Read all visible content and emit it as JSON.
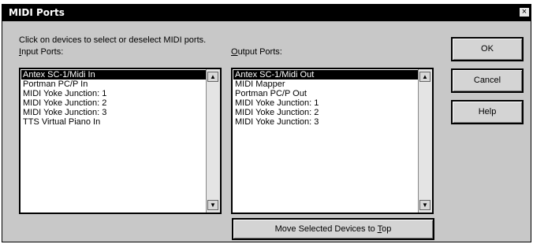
{
  "window": {
    "title": "MIDI Ports",
    "close_glyph": "×"
  },
  "instructions": "Click on devices to select or deselect MIDI ports.",
  "input": {
    "label_prefix": "I",
    "label_rest": "nput Ports:",
    "items": [
      {
        "label": "Antex SC-1/Midi In",
        "selected": true
      },
      {
        "label": "Portman PC/P In",
        "selected": false
      },
      {
        "label": "MIDI Yoke Junction:  1",
        "selected": false
      },
      {
        "label": "MIDI Yoke Junction:  2",
        "selected": false
      },
      {
        "label": "MIDI Yoke Junction:  3",
        "selected": false
      },
      {
        "label": "TTS Virtual Piano In",
        "selected": false
      }
    ]
  },
  "output": {
    "label_prefix": "O",
    "label_rest": "utput Ports:",
    "items": [
      {
        "label": "Antex SC-1/Midi Out",
        "selected": true
      },
      {
        "label": "MIDI Mapper",
        "selected": false
      },
      {
        "label": "Portman PC/P Out",
        "selected": false
      },
      {
        "label": "MIDI Yoke Junction:  1",
        "selected": false
      },
      {
        "label": "MIDI Yoke Junction:  2",
        "selected": false
      },
      {
        "label": "MIDI Yoke Junction:  3",
        "selected": false
      }
    ]
  },
  "buttons": {
    "ok": "OK",
    "cancel": "Cancel",
    "help": "Help",
    "move_prefix": "Move Selected Devices to ",
    "move_accel": "T",
    "move_suffix": "op"
  },
  "scroll": {
    "up_glyph": "▲",
    "down_glyph": "▼"
  }
}
